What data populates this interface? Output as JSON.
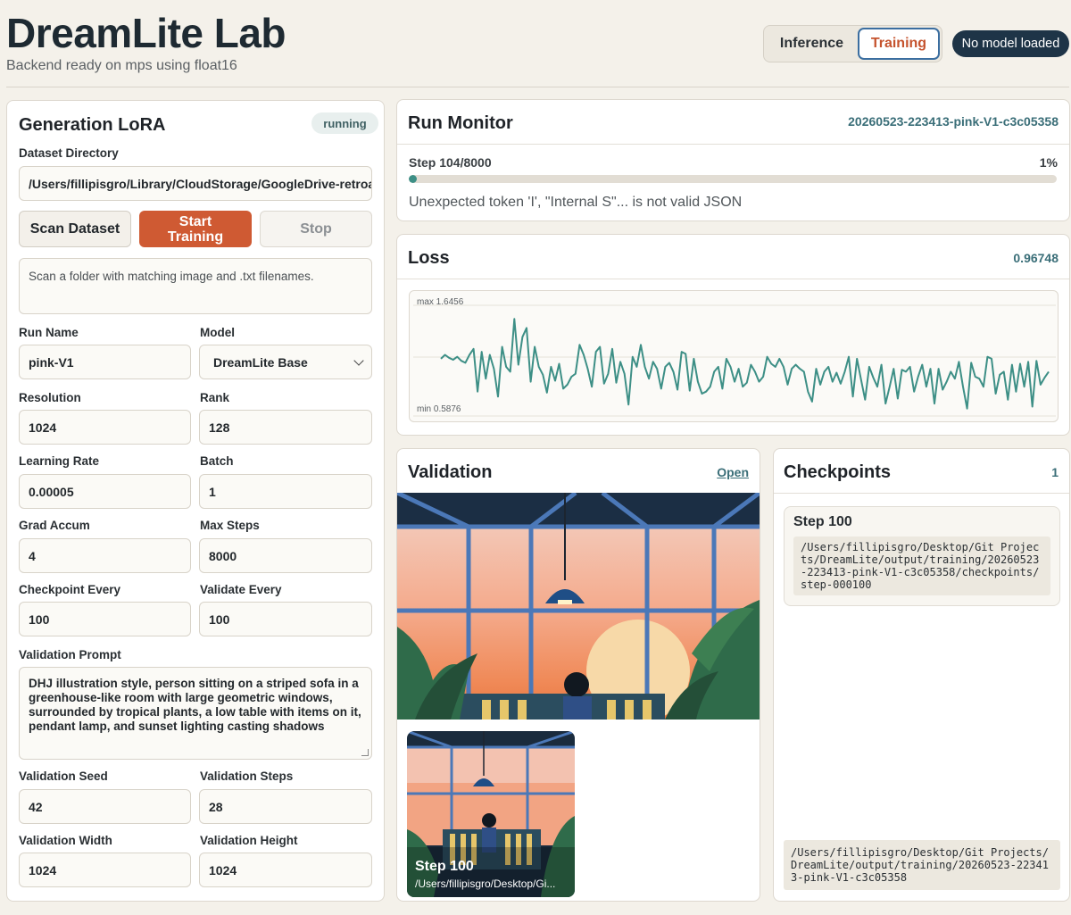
{
  "header": {
    "title": "DreamLite Lab",
    "subtitle": "Backend ready on mps using float16",
    "mode_inference": "Inference",
    "mode_training": "Training",
    "model_status": "No model loaded"
  },
  "lora": {
    "title": "Generation LoRA",
    "status": "running",
    "dataset_label": "Dataset Directory",
    "dataset_value": "/Users/fillipisgro/Library/CloudStorage/GoogleDrive-retroa",
    "scan_label": "Scan Dataset",
    "start_label": "Start Training",
    "stop_label": "Stop",
    "hint": "Scan a folder with matching image and .txt filenames.",
    "run_name_label": "Run Name",
    "run_name": "pink-V1",
    "model_label": "Model",
    "model": "DreamLite Base",
    "resolution_label": "Resolution",
    "resolution": "1024",
    "rank_label": "Rank",
    "rank": "128",
    "lr_label": "Learning Rate",
    "lr": "0.00005",
    "batch_label": "Batch",
    "batch": "1",
    "grad_label": "Grad Accum",
    "grad": "4",
    "max_steps_label": "Max Steps",
    "max_steps": "8000",
    "ckpt_every_label": "Checkpoint Every",
    "ckpt_every": "100",
    "val_every_label": "Validate Every",
    "val_every": "100",
    "prompt_label": "Validation Prompt",
    "prompt": "DHJ illustration style, person sitting on a striped sofa in a greenhouse-like room with large geometric windows, surrounded by tropical plants, a low table with items on it, pendant lamp, and sunset lighting casting shadows",
    "seed_label": "Validation Seed",
    "seed": "42",
    "vsteps_label": "Validation Steps",
    "vsteps": "28",
    "vwidth_label": "Validation Width",
    "vwidth": "1024",
    "vheight_label": "Validation Height",
    "vheight": "1024"
  },
  "monitor": {
    "title": "Run Monitor",
    "run_id": "20260523-223413-pink-V1-c3c05358",
    "step": "Step 104/8000",
    "percent": "1%",
    "progress": 0.013,
    "error": "Unexpected token 'I', \"Internal S\"... is not valid JSON"
  },
  "loss": {
    "title": "Loss",
    "current": "0.96748",
    "max_label": "max 1.6456",
    "min_label": "min 0.5876"
  },
  "chart_data": {
    "type": "line",
    "title": "Loss",
    "ylim": [
      0.5876,
      1.6456
    ],
    "series": [
      {
        "values": [
          1.18,
          1.22,
          1.19,
          1.17,
          1.2,
          1.16,
          1.14,
          1.22,
          1.28,
          0.85,
          1.25,
          0.98,
          1.22,
          1.08,
          0.8,
          1.3,
          1.1,
          1.05,
          1.58,
          1.12,
          1.4,
          1.49,
          0.95,
          1.3,
          1.1,
          1.02,
          0.84,
          1.1,
          0.96,
          1.13,
          0.88,
          0.92,
          1.0,
          1.03,
          1.32,
          1.22,
          1.08,
          0.9,
          1.25,
          1.3,
          0.93,
          1.03,
          1.28,
          0.94,
          1.15,
          1.03,
          0.72,
          1.2,
          1.1,
          1.32,
          1.1,
          0.98,
          1.15,
          1.08,
          0.88,
          1.1,
          1.14,
          1.05,
          0.87,
          1.25,
          1.23,
          0.86,
          1.18,
          0.95,
          0.83,
          0.85,
          0.9,
          1.05,
          1.1,
          0.88,
          1.18,
          1.1,
          0.95,
          1.08,
          0.9,
          0.94,
          1.12,
          1.05,
          0.95,
          1.0,
          1.2,
          1.13,
          1.1,
          1.18,
          1.1,
          0.92,
          1.08,
          1.12,
          1.08,
          1.05,
          0.85,
          0.75,
          1.08,
          0.92,
          1.05,
          1.1,
          0.95,
          1.04,
          0.93,
          1.05,
          1.2,
          0.8,
          1.18,
          0.97,
          0.77,
          1.1,
          0.99,
          0.9,
          1.12,
          0.73,
          0.9,
          1.08,
          0.78,
          1.07,
          1.05,
          1.1,
          0.85,
          1.0,
          1.12,
          0.9,
          1.08,
          0.73,
          1.08,
          0.87,
          0.95,
          1.05,
          0.98,
          1.15,
          0.9,
          0.68,
          1.14,
          1.0,
          0.98,
          0.9,
          1.2,
          1.18,
          0.83,
          1.02,
          1.05,
          0.77,
          1.12,
          0.85,
          1.13,
          0.9,
          1.15,
          0.7,
          1.16,
          0.92,
          0.99,
          1.05
        ]
      }
    ]
  },
  "validation": {
    "title": "Validation",
    "open_label": "Open",
    "thumb_step": "Step 100",
    "thumb_path": "/Users/fillipisgro/Desktop/Gi..."
  },
  "checkpoints": {
    "title": "Checkpoints",
    "count": "1",
    "card_step": "Step 100",
    "card_path": "/Users/fillipisgro/Desktop/Git Projects/DreamLite/output/training/20260523-223413-pink-V1-c3c05358/checkpoints/step-000100",
    "footer_path": "/Users/fillipisgro/Desktop/Git Projects/DreamLite/output/training/20260523-223413-pink-V1-c3c05358"
  },
  "colors": {
    "accent": "#cf5a33",
    "teal": "#3d8f86",
    "navy": "#1e3447"
  }
}
